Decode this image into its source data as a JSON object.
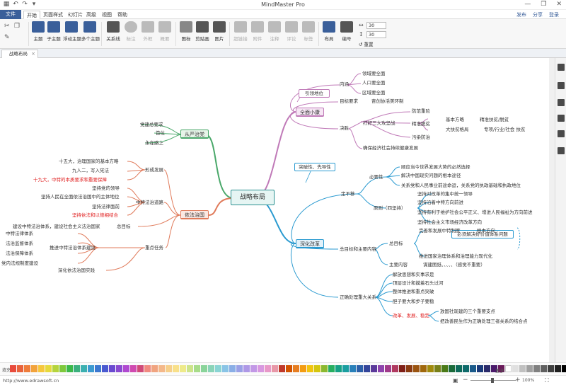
{
  "app": {
    "title": "MindMaster Pro"
  },
  "quick_access": [
    "▦",
    "↶",
    "↷",
    "▾"
  ],
  "window_buttons": [
    "—",
    "❐",
    "✕"
  ],
  "tabs": [
    "文件",
    "开始",
    "页面样式",
    "幻灯片",
    "高级",
    "视图",
    "帮助"
  ],
  "account": {
    "publish": "发布",
    "share": "分享",
    "login": "登录"
  },
  "ribbon": {
    "buttons": [
      {
        "label": "主题",
        "color": "#3a5f9a"
      },
      {
        "label": "子主题",
        "color": "#3a5f9a"
      },
      {
        "label": "浮动主题",
        "color": "#3a5f9a"
      },
      {
        "label": "多个主题",
        "color": "#3a5f9a"
      },
      {
        "label": "关系线",
        "color": "#555555"
      },
      {
        "label": "标注",
        "color": "#bbbbbb"
      },
      {
        "label": "外框",
        "color": "#bbbbbb"
      },
      {
        "label": "概要",
        "color": "#bbbbbb"
      },
      {
        "label": "图标",
        "color": "#888888"
      },
      {
        "label": "剪贴画",
        "color": "#555555"
      },
      {
        "label": "图片",
        "color": "#555555"
      },
      {
        "label": "超链接",
        "color": "#bbbbbb"
      },
      {
        "label": "附件",
        "color": "#bbbbbb"
      },
      {
        "label": "注释",
        "color": "#bbbbbb"
      },
      {
        "label": "评论",
        "color": "#bbbbbb"
      },
      {
        "label": "标签",
        "color": "#bbbbbb"
      },
      {
        "label": "布局",
        "color": "#3a5f9a"
      },
      {
        "label": "编号",
        "color": "#555555"
      }
    ],
    "spin1": "30",
    "spin2": "30",
    "reset": "重置"
  },
  "document_tab": "战略布局",
  "mindmap": {
    "center": "战略布局",
    "main": {
      "quanmian": "全面小康",
      "conglian": "从严治党",
      "yifa": "依法治国",
      "shenhua": "深化改革"
    },
    "callout1": "引领地位",
    "callout2": "突破性、先导性",
    "callout3": "必须解决好价值体系问题",
    "nodes": {
      "n1": "内涵",
      "n2": "领域要全面",
      "n3": "人口要全面",
      "n4": "区域要全面",
      "n5": "目标要求",
      "n6": "奋创协活美环制",
      "n7": "决胜",
      "n8": "打好三大攻坚战",
      "n9": "防范重险",
      "n10": "精准脱贫",
      "n11": "基本方略",
      "n12": "精准扶贫/脱贫",
      "n13": "大扶贫格局",
      "n14": "专项/行业/社会  扶贫",
      "n15": "污染防治",
      "n16": "确保经济社会持续健康发展",
      "c1": "党建总要求",
      "c2": "首位",
      "c3": "永在路上",
      "y1": "形成发展",
      "y2": "十五大，治理国家的基本方略",
      "y3": "九人二，写入宪法",
      "y4": "十九大，中特的本质要求和重要保障",
      "y5": "中特法治道路",
      "y6": "坚持党的领导",
      "y7": "坚持人民在全面依法治国中的主体地位",
      "y8": "坚持法律面前",
      "y9": "坚持依法和以德相结合",
      "y10": "总目标",
      "y11": "建设中特法治体系，建设社会主义法治国家",
      "y12": "重点任务",
      "y13": "推进中特法治体系建设",
      "y14": "中特法律体系",
      "y15": "法治监督体系",
      "y16": "法治保障体系",
      "y17": "党内法规制度建设",
      "y18": "深化依法治国实践",
      "s1": "定不移",
      "s2": "必要性",
      "s3": "顺应当今世界发展大势的必然选择",
      "s4": "解决中国现实问题的根本途径",
      "s5": "关系党和人民事业前途命运，关系党的执政基础和执政地位",
      "s6": "原则（四坚持）",
      "s7": "坚持对改革的集中统一领导",
      "s8": "坚持沿着中特方向前进",
      "s9": "坚持有利于维护社会公平正义、增进人民福祉为方向前进",
      "s10": "坚持社会主义市场经济改革方向",
      "s11": "总目标和主要内容",
      "s12": "总目标",
      "s13": "完善和发展中特制度",
      "s14": "根本方向",
      "s15": "推进国家治理体系和治理能力现代化",
      "s16": "主要内容",
      "s17": "谋建图纸、、、、、（感觉不重要）",
      "s18": "正确处理重大关系",
      "s19": "解放思想和实事求是",
      "s20": "顶层设计和摸着石头过河",
      "s21": "整体推进和重点突破",
      "s22": "胆子要大和步子要稳",
      "s23": "改革、发展、稳定",
      "s24": "放国社现建的三个重要支点",
      "s25": "把改善民生作为正确处理三者关系的结合点"
    }
  },
  "palette": {
    "label": "填充",
    "more": "更多",
    "colors": [
      "#e84b3c",
      "#e8633c",
      "#ee7d3c",
      "#f2a33c",
      "#f6c73c",
      "#e6d93c",
      "#b5d43c",
      "#7ec83c",
      "#3cb84a",
      "#3cb07e",
      "#3cb0b0",
      "#3c9ad0",
      "#3c78d0",
      "#4a5ad0",
      "#6a4ad0",
      "#8a4ad0",
      "#b04ad0",
      "#d04ab0",
      "#d04a78",
      "#f08a80",
      "#f0a480",
      "#f4b88a",
      "#f6cf8a",
      "#f8e08a",
      "#eeea8a",
      "#cde48a",
      "#a8dc8a",
      "#8ad49a",
      "#8ad4b8",
      "#8ad4d4",
      "#8ac4e6",
      "#8aaee6",
      "#9aa0e6",
      "#ae98e6",
      "#c298e6",
      "#d898e0",
      "#e898c8",
      "#e898a8",
      "#c0392b",
      "#d35400",
      "#e67e22",
      "#f39c12",
      "#f1c40f",
      "#d4c60f",
      "#8bb82f",
      "#27ae60",
      "#16a085",
      "#1a9ea0",
      "#2980b9",
      "#2c5fa8",
      "#34459a",
      "#5b3a9a",
      "#8e44ad",
      "#a03a8a",
      "#b03a60",
      "#7f1f17",
      "#8a3a10",
      "#9a5410",
      "#a0680c",
      "#a08a0c",
      "#788018",
      "#4a7a18",
      "#1a6a3a",
      "#0e6a5a",
      "#0e6a6a",
      "#1a5a8a",
      "#1a3a7a",
      "#2a2a6a",
      "#4a1a6a",
      "#6a1a5a",
      "#ffffff",
      "#e0e0e0",
      "#c0c0c0",
      "#a0a0a0",
      "#808080",
      "#606060",
      "#404040",
      "#202020",
      "#000000"
    ]
  },
  "status": {
    "url": "http://www.edrawsoft.cn",
    "zoom": "100%"
  }
}
